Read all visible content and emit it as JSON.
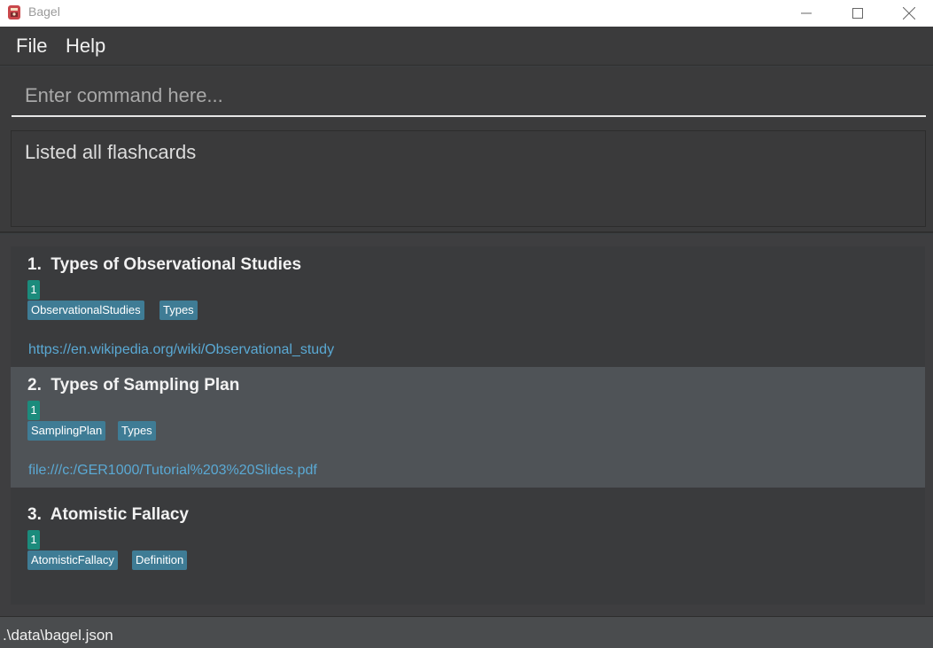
{
  "window": {
    "title": "Bagel"
  },
  "menu": {
    "file": "File",
    "help": "Help"
  },
  "command": {
    "placeholder": "Enter command here...",
    "value": ""
  },
  "result": {
    "text": "Listed all flashcards"
  },
  "flashcards": [
    {
      "index": "1.",
      "title": "Types of Observational Studies",
      "count": "1",
      "tags": [
        "ObservationalStudies",
        "Types"
      ],
      "link": "https://en.wikipedia.org/wiki/Observational_study"
    },
    {
      "index": "2.",
      "title": "Types of Sampling Plan",
      "count": "1",
      "tags": [
        "SamplingPlan",
        "Types"
      ],
      "link": "file:///c:/GER1000/Tutorial%203%20Slides.pdf"
    },
    {
      "index": "3.",
      "title": "Atomistic Fallacy",
      "count": "1",
      "tags": [
        "AtomisticFallacy",
        "Definition"
      ],
      "link": ""
    }
  ],
  "status": {
    "path": ".\\data\\bagel.json"
  },
  "colors": {
    "background": "#3c3f41",
    "selected": "#4f5357",
    "count_badge": "#1b8b7c",
    "tag": "#3f7c95",
    "link": "#5aa9d4"
  },
  "icons": [
    "app-icon",
    "minimize-icon",
    "maximize-icon",
    "close-icon"
  ]
}
